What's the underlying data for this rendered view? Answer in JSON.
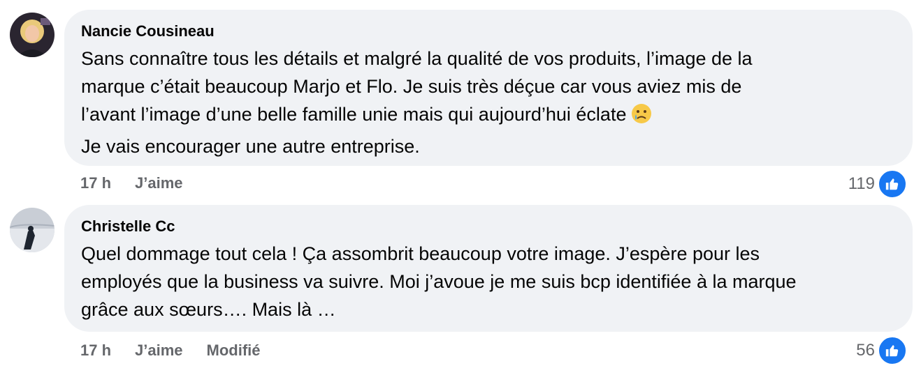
{
  "comments": [
    {
      "author": "Nancie Cousineau",
      "lines": [
        "Sans connaître tous les détails et malgré la qualité de vos produits, l’image de la",
        "marque c’était beaucoup Marjo et Flo. Je suis très déçue car vous aviez mis de",
        "l’avant l’image d’une belle famille unie mais qui aujourd’hui éclate",
        "Je vais encourager une autre entreprise."
      ],
      "emoji": "sad-tear-emoji",
      "time": "17 h",
      "like_label": "J’aime",
      "reaction_count": "119",
      "reaction_icon": "thumbs-up-icon"
    },
    {
      "author": "Christelle Cc",
      "lines": [
        "Quel dommage tout cela ! Ça assombrit beaucoup votre image. J’espère pour les",
        "employés que la business va suivre. Moi j’avoue je me suis bcp identifiée à la marque",
        "grâce aux sœurs…. Mais là …"
      ],
      "time": "17 h",
      "like_label": "J’aime",
      "edited_label": "Modifié",
      "reaction_count": "56",
      "reaction_icon": "thumbs-up-icon"
    }
  ],
  "colors": {
    "bubble": "#f0f2f5",
    "meta_text": "#65676b",
    "like_blue": "#1877f2"
  }
}
